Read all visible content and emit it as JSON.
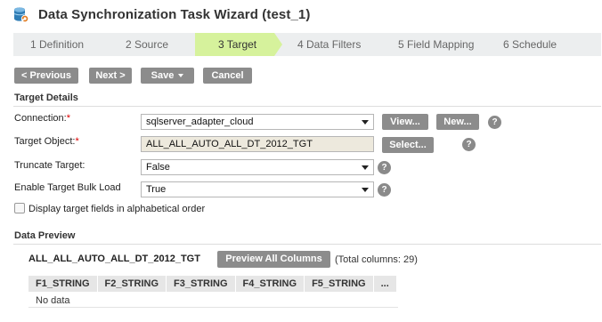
{
  "window": {
    "title": "Data Synchronization Task Wizard (test_1)",
    "icon": "data-sync-icon"
  },
  "steps": [
    {
      "label": "1  Definition",
      "active": false
    },
    {
      "label": "2  Source",
      "active": false
    },
    {
      "label": "3  Target",
      "active": true
    },
    {
      "label": "4  Data Filters",
      "active": false
    },
    {
      "label": "5  Field Mapping",
      "active": false
    },
    {
      "label": "6  Schedule",
      "active": false
    }
  ],
  "toolbar": {
    "previous": "< Previous",
    "next": "Next >",
    "save": "Save",
    "cancel": "Cancel"
  },
  "target_details": {
    "section_title": "Target Details",
    "connection": {
      "label": "Connection:",
      "required": "*",
      "value": "sqlserver_adapter_cloud",
      "view_button": "View...",
      "new_button": "New..."
    },
    "target_object": {
      "label": "Target Object:",
      "required": "*",
      "value": "ALL_ALL_AUTO_ALL_DT_2012_TGT",
      "select_button": "Select..."
    },
    "truncate_target": {
      "label": "Truncate Target:",
      "value": "False"
    },
    "bulk_load": {
      "label": "Enable Target Bulk Load",
      "value": "True"
    },
    "alphabetical": {
      "label": "Display target fields in alphabetical order",
      "checked": false
    },
    "help_glyph": "?"
  },
  "data_preview": {
    "section_title": "Data Preview",
    "object_name": "ALL_ALL_AUTO_ALL_DT_2012_TGT",
    "preview_button": "Preview All Columns",
    "total_columns": "(Total columns: 29)",
    "columns": [
      "F1_STRING",
      "F2_STRING",
      "F3_STRING",
      "F4_STRING",
      "F5_STRING",
      "..."
    ],
    "empty_text": "No data"
  },
  "colors": {
    "active_step": "#d6f29c",
    "button": "#8c8c8c",
    "required": "#dd0000",
    "readonly_field": "#ede9dd"
  }
}
